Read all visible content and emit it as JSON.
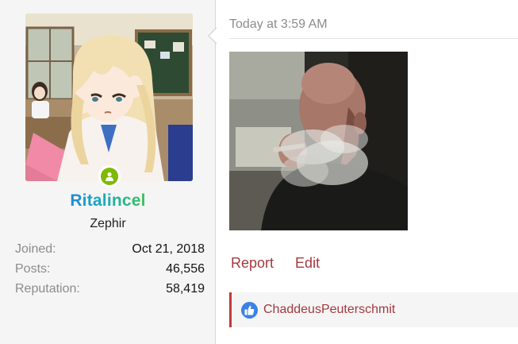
{
  "author": {
    "username": "Ritalincel",
    "user_title": "Zephir",
    "status": "online",
    "stats": [
      {
        "label": "Joined:",
        "value": "Oct 21, 2018"
      },
      {
        "label": "Posts:",
        "value": "46,556"
      },
      {
        "label": "Reputation:",
        "value": "58,419"
      }
    ]
  },
  "post": {
    "date": "Today at 3:59 AM",
    "actions": {
      "report": "Report",
      "edit": "Edit"
    },
    "likes": {
      "icon": "thumbs-up-icon",
      "user": "ChaddeusPeuterschmit"
    }
  },
  "colors": {
    "link": "#a4393d",
    "likes_accent": "#c0393b",
    "online": "#7fb900",
    "like_badge": "#3b82e6",
    "muted": "#8c8c8c",
    "panel_bg": "#f5f5f5"
  }
}
